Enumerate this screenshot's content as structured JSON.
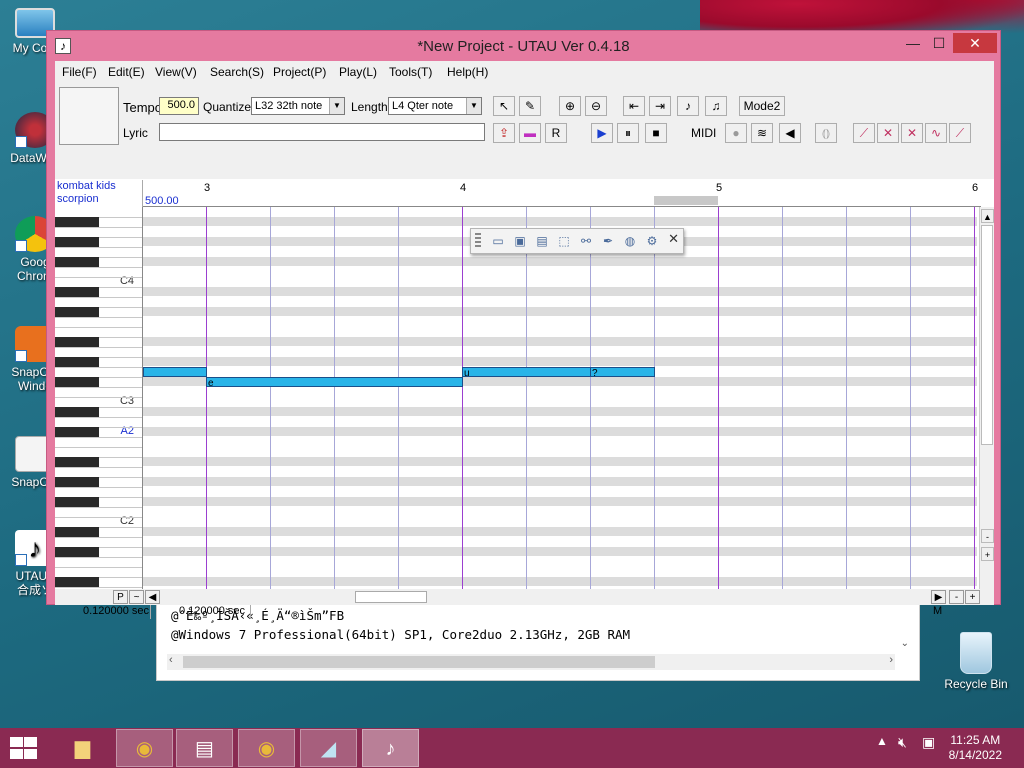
{
  "desktop": {
    "icons": [
      {
        "name": "my-computer",
        "label": "My Com"
      },
      {
        "name": "datawag",
        "label": "DataWag"
      },
      {
        "name": "google-chrome",
        "label": "Goog\nChrom"
      },
      {
        "name": "snapcrab-windows",
        "label": "SnapCra\nWindo"
      },
      {
        "name": "snapcrab",
        "label": "SnapCra"
      },
      {
        "name": "utau",
        "label": "UTAU -\n合成ソ"
      },
      {
        "name": "recycle-bin",
        "label": "Recycle Bin"
      }
    ]
  },
  "background_window": {
    "line1": "@ˆÈ‰º¸ÌŠÂ‹«¸É¸Ä“®ìŠm”FB",
    "line2": "@Windows 7 Professional(64bit) SP1, Core2duo 2.13GHz, 2GB RAM"
  },
  "window": {
    "title": "*New Project - UTAU Ver 0.4.18",
    "minimize": "—",
    "maximize": "☐",
    "close": "✕",
    "app_icon": "♪"
  },
  "menu": [
    "File(F)",
    "Edit(E)",
    "View(V)",
    "Search(S)",
    "Project(P)",
    "Play(L)",
    "Tools(T)",
    "Help(H)"
  ],
  "toolbar": {
    "tempo_label": "Tempo",
    "tempo_value": "500.0",
    "quantize_label": "Quantize",
    "quantize_value": "L32 32th note",
    "length_label": "Length",
    "length_value": "L4  Qter note",
    "lyric_label": "Lyric",
    "lyric_value": "",
    "mode_button": "Mode2",
    "midi_label": "MIDI"
  },
  "roll": {
    "track_name_line1": "kombat kids",
    "track_name_line2": "scorpion",
    "tempo_mark": "500.00",
    "measures": [
      "3",
      "4",
      "5",
      "6"
    ],
    "key_labels": [
      "C4",
      "C3",
      "A2",
      "C2"
    ],
    "notes": [
      {
        "lyric": ""
      },
      {
        "lyric": "e"
      },
      {
        "lyric": "u"
      },
      {
        "lyric": "?"
      }
    ]
  },
  "hscroll": {
    "p_button": "P",
    "tilde_button": "~",
    "minus_button": "-",
    "plus_button": "+"
  },
  "vscroll": {
    "minus": "-",
    "plus": "+"
  },
  "status": {
    "left_time": "0.120000 sec",
    "right_time": "0.120000 sec",
    "mode": "M"
  },
  "taskbar": {
    "time": "11:25 AM",
    "date": "8/14/2022"
  },
  "colors": {
    "window_frame": "#e57aa0",
    "taskbar": "#8a2a52",
    "note": "#29b4e8",
    "bar_line": "#9b3fd0"
  }
}
